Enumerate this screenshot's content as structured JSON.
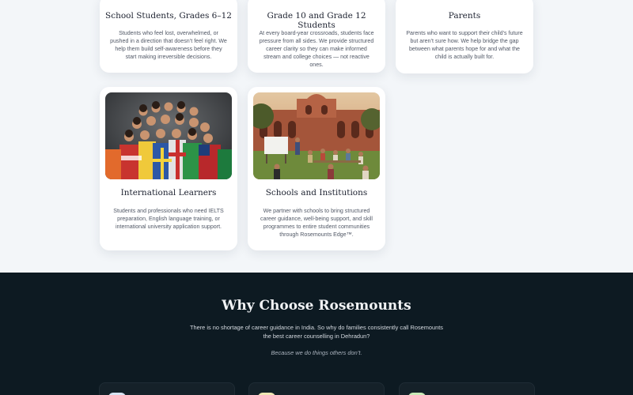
{
  "audience_cards": [
    {
      "title": "School Students, Grades 6–12",
      "description": "Students who feel lost, overwhelmed, or pushed in a direction that doesn’t feel right. We help them build self-awareness before they start making irreversible decisions."
    },
    {
      "title": "Grade 10 and Grade 12 Students",
      "description": "At every board-year crossroads, students face pressure from all sides. We provide structured career clarity so they can make informed stream and college choices — not reactive ones."
    },
    {
      "title": "Parents",
      "description": "Parents who want to support their child’s future but aren’t sure how. We help bridge the gap between what parents hope for and what the child is actually built for."
    },
    {
      "title": "International Learners",
      "description": "Students and professionals who need IELTS preparation, English language training, or international university application support.",
      "image": "students-with-world-flags-photo"
    },
    {
      "title": "Schools and Institutions",
      "description": "We partner with schools to bring structured career guidance, well-being support, and skill programmes to entire student communities through Rosemounts Edge™.",
      "image": "outdoor-campus-classroom-photo"
    }
  ],
  "why_section": {
    "title": "Why Choose Rosemounts",
    "intro": "There is no shortage of career guidance in India. So why do families consistently call Rosemounts the best career counselling in Dehradun?",
    "tagline": "Because we do things others don’t."
  },
  "colors": {
    "page_background": "#f3f6f9",
    "card_background": "#ffffff",
    "dark_section": "#0d1a22",
    "feature_icon_1": "#d7e4f3",
    "feature_icon_2": "#efe7b4",
    "feature_icon_3": "#c8eab7"
  }
}
